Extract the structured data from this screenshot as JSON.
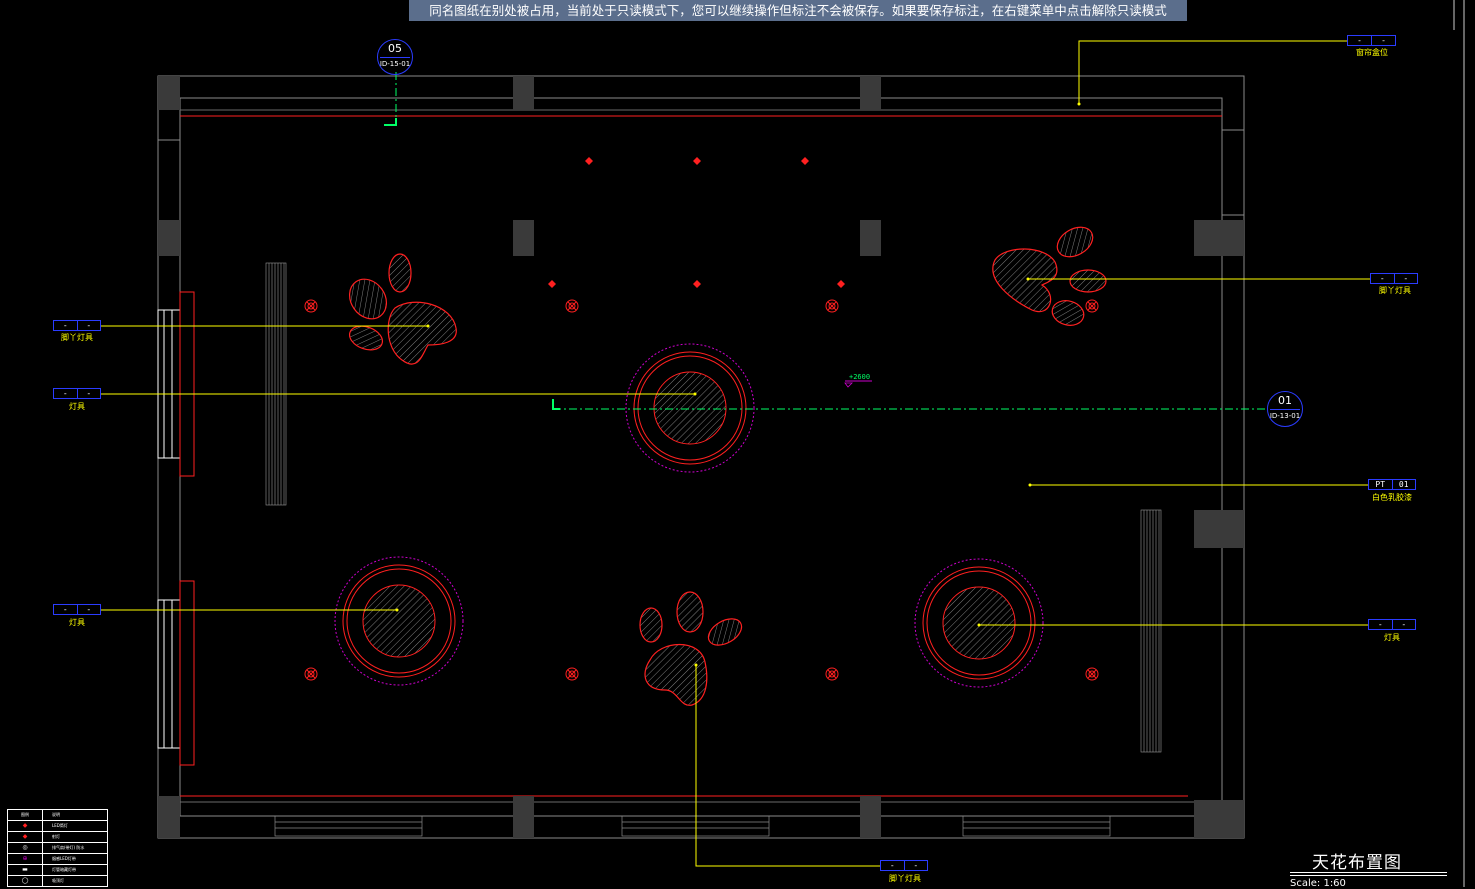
{
  "banner": {
    "text": "同名图纸在别处被占用，当前处于只读模式下，您可以继续操作但标注不会被保存。如果要保存标注，在右键菜单中点击解除只读模式"
  },
  "drawing": {
    "title": "天花布置图",
    "scale": "Scale: 1:60",
    "level": "+2600"
  },
  "section_marks": [
    {
      "num": "05",
      "ref": "ID-15-01"
    },
    {
      "num": "01",
      "ref": "ID-13-01"
    }
  ],
  "tags": {
    "top_right": {
      "a": "-",
      "b": "-",
      "label": "窗帘盒位"
    },
    "right_paw": {
      "a": "-",
      "b": "-",
      "label": "脚丫灯具"
    },
    "left_paw": {
      "a": "-",
      "b": "-",
      "label": "脚丫灯具"
    },
    "left_center": {
      "a": "-",
      "b": "-",
      "label": "灯具"
    },
    "paint": {
      "a": "PT",
      "b": "01",
      "label": "白色乳胶漆"
    },
    "left_bottom": {
      "a": "-",
      "b": "-",
      "label": "灯具"
    },
    "right_bottom": {
      "a": "-",
      "b": "-",
      "label": "灯具"
    },
    "bottom_paw": {
      "a": "-",
      "b": "-",
      "label": "脚丫灯具"
    }
  },
  "legend": {
    "header": [
      "图例",
      "说明"
    ],
    "rows": [
      {
        "sym": "◆",
        "text": "LED筒灯"
      },
      {
        "sym": "◆",
        "text": "射灯"
      },
      {
        "sym": "◎",
        "text": "排气扇(带灯) 防水"
      },
      {
        "sym": "⊕",
        "text": "烟感LED灯带"
      },
      {
        "sym": "▬",
        "text": "灯管暗藏灯带"
      },
      {
        "sym": "◯",
        "text": "吸顶灯"
      }
    ]
  },
  "colors": {
    "background": "#000000",
    "wall": "#8a8a8a",
    "column": "#3a3a3a",
    "red": "#ff2020",
    "yellow": "#ffff00",
    "magenta": "#cc00cc",
    "blue": "#2b3cff",
    "green": "#00ff66"
  }
}
